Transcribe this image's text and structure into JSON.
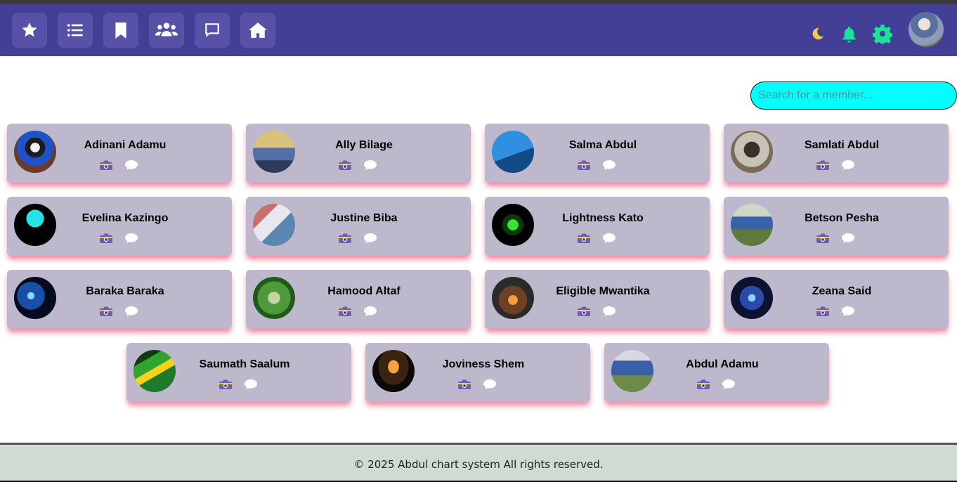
{
  "nav": {
    "buttons": [
      {
        "icon": "star-icon"
      },
      {
        "icon": "list-icon"
      },
      {
        "icon": "bookmark-icon"
      },
      {
        "icon": "users-icon"
      },
      {
        "icon": "chat-icon"
      },
      {
        "icon": "home-icon"
      }
    ],
    "right_icons": [
      "moon-icon",
      "bell-icon",
      "gear-icon"
    ],
    "colors": {
      "navbar": "#433e96",
      "button": "#5752a7",
      "accent": "#19e29a",
      "moon": "#f2c94c"
    }
  },
  "search": {
    "placeholder": "Search for a member..."
  },
  "members": [
    {
      "name": "Adinani Adamu"
    },
    {
      "name": "Ally Bilage"
    },
    {
      "name": "Salma Abdul"
    },
    {
      "name": "Samlati Abdul"
    },
    {
      "name": "Evelina Kazingo"
    },
    {
      "name": "Justine Biba"
    },
    {
      "name": "Lightness Kato"
    },
    {
      "name": "Betson Pesha"
    },
    {
      "name": "Baraka Baraka"
    },
    {
      "name": "Hamood Altaf"
    },
    {
      "name": "Eligible Mwantika"
    },
    {
      "name": "Zeana Said"
    },
    {
      "name": "Saumath Saalum"
    },
    {
      "name": "Joviness Shem"
    },
    {
      "name": "Abdul Adamu"
    }
  ],
  "footer": {
    "text": "© 2025 Abdul chart system All rights reserved."
  }
}
